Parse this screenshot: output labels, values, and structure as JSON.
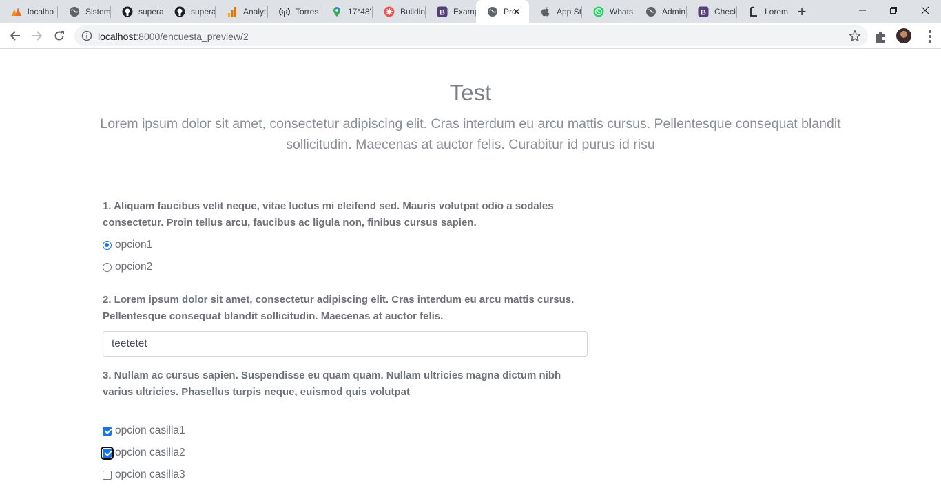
{
  "browser": {
    "tabs": [
      {
        "label": "localho",
        "icon": "pma-icon"
      },
      {
        "label": "Sistem",
        "icon": "globe-icon"
      },
      {
        "label": "supera",
        "icon": "github-icon"
      },
      {
        "label": "supera",
        "icon": "github-icon"
      },
      {
        "label": "Analyti",
        "icon": "analytics-icon"
      },
      {
        "label": "Torres",
        "icon": "antenna-icon"
      },
      {
        "label": "17°48'",
        "icon": "maps-pin-icon"
      },
      {
        "label": "Buildin",
        "icon": "flower-icon"
      },
      {
        "label": "Examp",
        "icon": "bootstrap-icon"
      },
      {
        "label": "Pre",
        "icon": "globe-icon"
      },
      {
        "label": "App St",
        "icon": "apple-icon"
      },
      {
        "label": "Whats",
        "icon": "whatsapp-icon"
      },
      {
        "label": "Admin",
        "icon": "globe-icon"
      },
      {
        "label": "Check",
        "icon": "bootstrap-icon"
      },
      {
        "label": "Lorem",
        "icon": "lorem-icon"
      }
    ],
    "active_tab_index": 9,
    "url_host": "localhost",
    "url_path": ":8000/encuesta_preview/2"
  },
  "survey": {
    "title": "Test",
    "description": "Lorem ipsum dolor sit amet, consectetur adipiscing elit. Cras interdum eu arcu mattis cursus. Pellentesque consequat blandit sollicitudin. Maecenas at auctor felis. Curabitur id purus id risu",
    "questions": [
      {
        "text": "1. Aliquam faucibus velit neque, vitae luctus mi eleifend sed. Mauris volutpat odio a sodales consectetur. Proin tellus arcu, faucibus ac ligula non, finibus cursus sapien.",
        "type": "radio",
        "options": [
          {
            "label": "opcion1",
            "checked": true
          },
          {
            "label": "opcion2",
            "checked": false
          }
        ]
      },
      {
        "text": "2. Lorem ipsum dolor sit amet, consectetur adipiscing elit. Cras interdum eu arcu mattis cursus. Pellentesque consequat blandit sollicitudin. Maecenas at auctor felis.",
        "type": "text",
        "value": "teetetet"
      },
      {
        "text": "3. Nullam ac cursus sapien. Suspendisse eu quam quam. Nullam ultricies magna dictum nibh varius ultricies. Phasellus turpis neque, euismod quis volutpat",
        "type": "checkbox",
        "options": [
          {
            "label": "opcion casilla1",
            "checked": true
          },
          {
            "label": "opcion casilla2",
            "checked": true
          },
          {
            "label": "opcion casilla3",
            "checked": false
          }
        ]
      }
    ]
  },
  "colors": {
    "accent": "#1a73e8",
    "text_muted": "#6d7178",
    "tabstrip": "#dee1e6"
  }
}
